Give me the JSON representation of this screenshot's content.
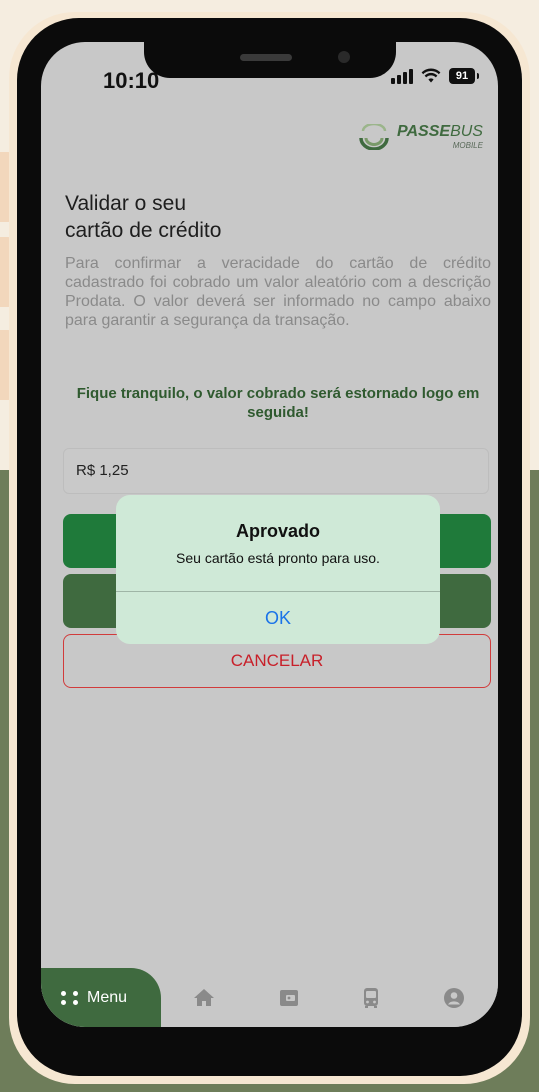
{
  "status_bar": {
    "time": "10:10",
    "battery": "91"
  },
  "logo": {
    "brand_bold": "PASSE",
    "brand_light": "BUS",
    "subtitle": "MOBILE"
  },
  "page": {
    "title_line1": "Validar o seu",
    "title_line2": "cartão de crédito",
    "description": "Para confirmar a veracidade do cartão de crédito cadastrado foi cobrado um valor aleatório com a descrição Prodata. O valor deverá ser informado no campo abaixo para garantir a segurança da transação.",
    "note": "Fique tranquilo, o valor cobrado será estornado logo em seguida!"
  },
  "amount_input": {
    "value": "R$ 1,25"
  },
  "buttons": {
    "cancel_label": "CANCELAR"
  },
  "dialog": {
    "title": "Aprovado",
    "message": "Seu cartão está pronto para uso.",
    "ok_label": "OK"
  },
  "tabbar": {
    "menu_label": "Menu",
    "icons": [
      "home-icon",
      "wallet-icon",
      "bus-icon",
      "account-icon"
    ]
  },
  "colors": {
    "primary_green": "#1f7a3a",
    "dark_green": "#3f6a3f",
    "cancel_red": "#c8202a",
    "link_blue": "#1a73e8"
  }
}
